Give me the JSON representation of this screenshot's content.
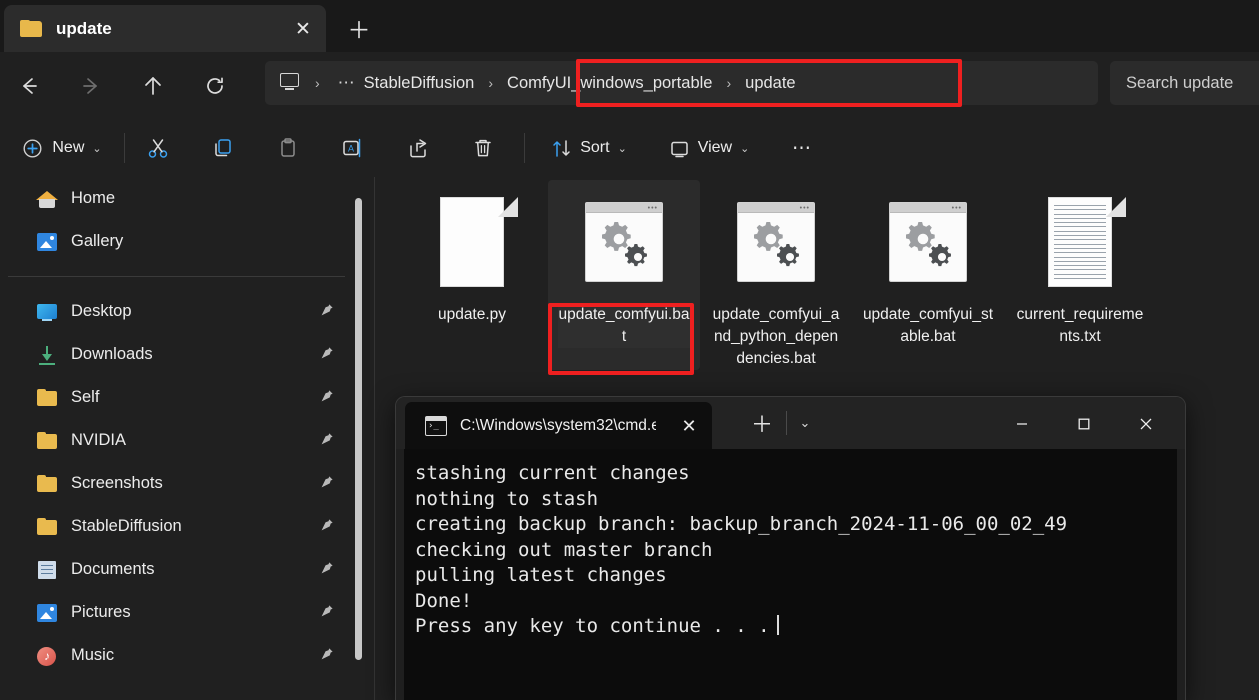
{
  "window": {
    "tab": {
      "title": "update",
      "folder_icon": "folder-icon",
      "close_label": "✕"
    },
    "new_tab_label": "＋"
  },
  "nav": {
    "back_icon": "arrow-left-icon",
    "forward_icon": "arrow-right-icon",
    "up_icon": "arrow-up-icon",
    "refresh_icon": "refresh-icon"
  },
  "breadcrumb": {
    "pc_icon": "this-pc-icon",
    "overflow": "⋯",
    "sep": "›",
    "items": [
      {
        "label": "StableDiffusion",
        "highlighted": false
      },
      {
        "label": "ComfyUI_windows_portable",
        "highlighted": true
      },
      {
        "label": "update",
        "highlighted": true
      }
    ]
  },
  "search": {
    "placeholder": "Search update"
  },
  "toolbar": {
    "new_label": "New",
    "new_icon": "plus-circle-icon",
    "cut_icon": "scissors-icon",
    "copy_icon": "copy-icon",
    "paste_icon": "paste-icon",
    "rename_icon": "rename-icon",
    "share_icon": "share-icon",
    "delete_icon": "trash-icon",
    "sort_label": "Sort",
    "sort_icon": "sort-icon",
    "view_label": "View",
    "view_icon": "view-icon",
    "more_label": "⋯",
    "chevron": "⌄"
  },
  "sidebar": {
    "items": [
      {
        "label": "Home",
        "icon": "home-icon",
        "pinned": false
      },
      {
        "label": "Gallery",
        "icon": "gallery-icon",
        "pinned": false
      },
      {
        "label": "Desktop",
        "icon": "desktop-icon",
        "pinned": true
      },
      {
        "label": "Downloads",
        "icon": "download-icon",
        "pinned": true
      },
      {
        "label": "Self",
        "icon": "folder-icon",
        "pinned": true
      },
      {
        "label": "NVIDIA",
        "icon": "folder-icon",
        "pinned": true
      },
      {
        "label": "Screenshots",
        "icon": "folder-icon",
        "pinned": true
      },
      {
        "label": "StableDiffusion",
        "icon": "folder-icon",
        "pinned": true
      },
      {
        "label": "Documents",
        "icon": "documents-icon",
        "pinned": true
      },
      {
        "label": "Pictures",
        "icon": "pictures-icon",
        "pinned": true
      },
      {
        "label": "Music",
        "icon": "music-icon",
        "pinned": true
      }
    ],
    "pin_glyph": "📌"
  },
  "files": [
    {
      "name": "update.py",
      "icon": "python-file-icon",
      "kind": "page",
      "selected": false
    },
    {
      "name": "update_comfyui.bat",
      "icon": "bat-file-icon",
      "kind": "bat",
      "selected": true
    },
    {
      "name": "update_comfyui_and_python_dependencies.bat",
      "icon": "bat-file-icon",
      "kind": "bat",
      "selected": false
    },
    {
      "name": "update_comfyui_stable.bat",
      "icon": "bat-file-icon",
      "kind": "bat",
      "selected": false
    },
    {
      "name": "current_requirements.txt",
      "icon": "text-file-icon",
      "kind": "page",
      "selected": false
    }
  ],
  "terminal": {
    "tab_title": "C:\\Windows\\system32\\cmd.e",
    "tab_icon": "console-icon",
    "tab_close": "✕",
    "new_tab": "＋",
    "dropdown": "⌄",
    "minimize": "─",
    "maximize": "☐",
    "close": "✕",
    "lines": [
      "stashing current changes",
      "nothing to stash",
      "creating backup branch: backup_branch_2024-11-06_00_02_49",
      "checking out master branch",
      "pulling latest changes",
      "Done!",
      "Press any key to continue . . ."
    ]
  },
  "annotations": {
    "color": "#ef2020",
    "boxes": [
      "breadcrumb-highlight",
      "selected-file-highlight"
    ]
  }
}
